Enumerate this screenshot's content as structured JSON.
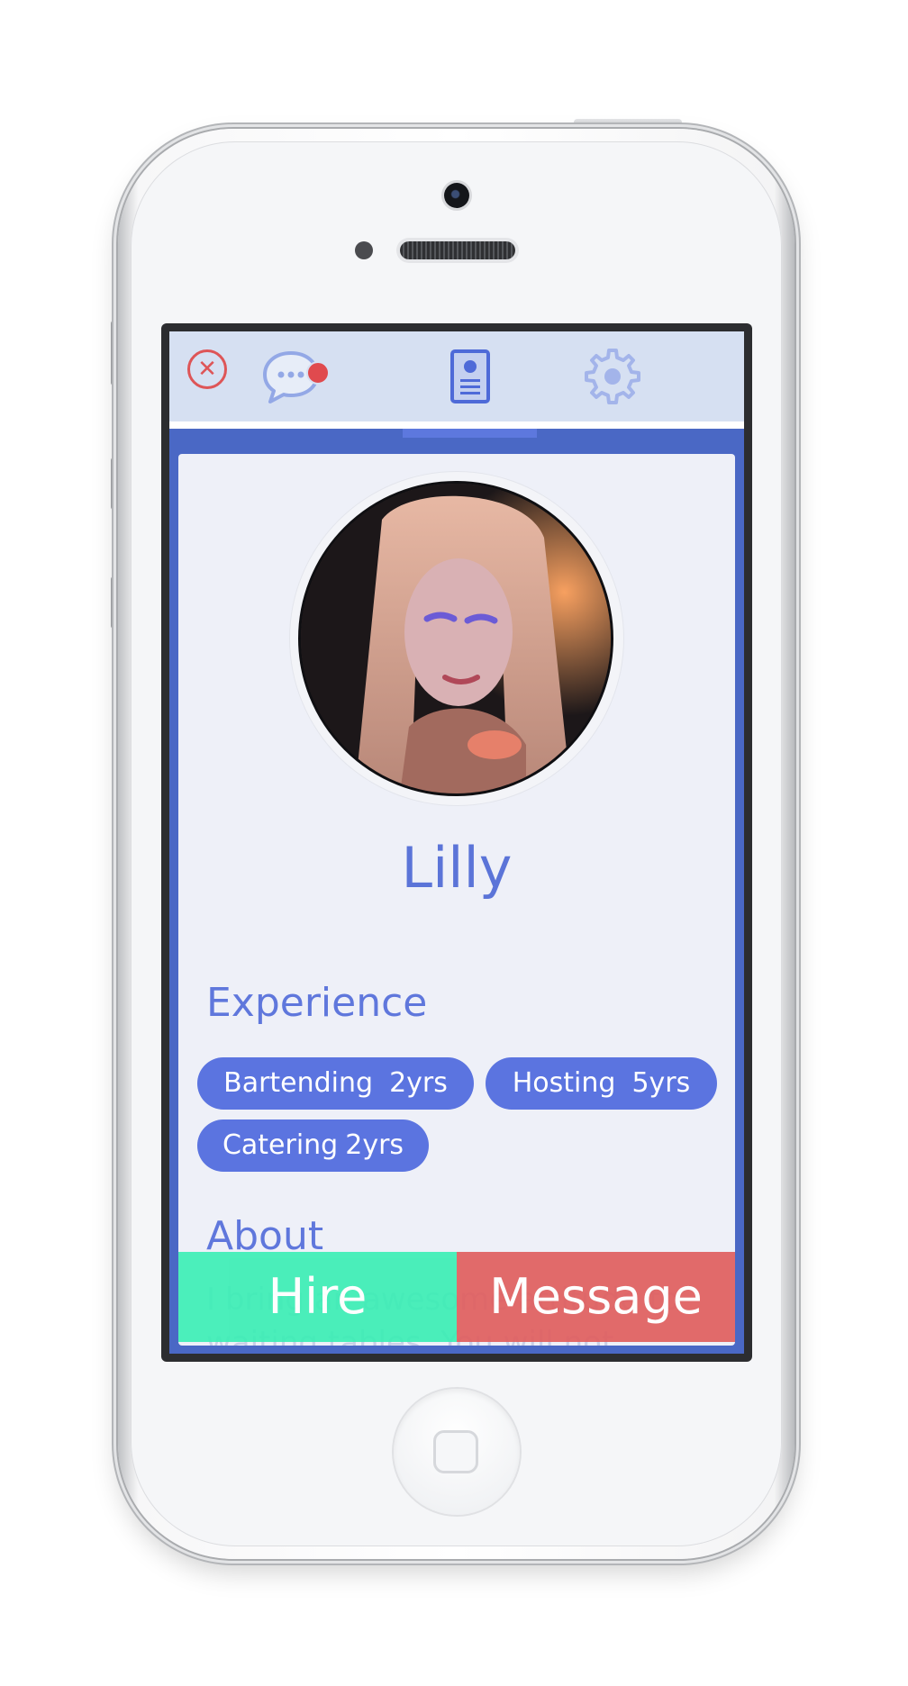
{
  "nav": {
    "tabs": [
      {
        "id": "messages",
        "icon": "chat-bubble-icon",
        "has_badge": true
      },
      {
        "id": "profile",
        "icon": "profile-card-icon",
        "active": true
      },
      {
        "id": "settings",
        "icon": "gear-icon"
      }
    ],
    "close_icon": "close-icon"
  },
  "profile": {
    "name": "Lilly",
    "experience_title": "Experience",
    "skills": [
      {
        "label": "Bartending",
        "years": "2yrs"
      },
      {
        "label": "Hosting",
        "years": "5yrs"
      },
      {
        "label": "Catering",
        "years": "2yrs"
      }
    ],
    "about_title": "About",
    "about_text": "I bring an awesome attitude to waiting tables. You will not regret"
  },
  "actions": {
    "hire_label": "Hire",
    "message_label": "Message"
  },
  "colors": {
    "accent": "#5b74e0",
    "hire": "#3aeeb4",
    "message": "#e06060",
    "frame": "#4a68c5",
    "badge": "#e04a4e"
  }
}
